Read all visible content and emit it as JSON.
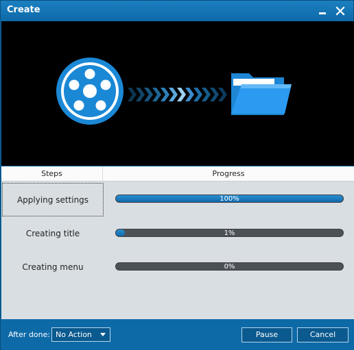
{
  "window": {
    "title": "Create"
  },
  "table": {
    "header_steps": "Steps",
    "header_progress": "Progress",
    "rows": [
      {
        "step": "Applying settings",
        "progress": 100,
        "progress_text": "100%"
      },
      {
        "step": "Creating title",
        "progress": 1,
        "progress_text": "1%"
      },
      {
        "step": "Creating menu",
        "progress": 0,
        "progress_text": "0%"
      }
    ]
  },
  "footer": {
    "after_done_label": "After done:",
    "after_done_value": "No Action",
    "pause_label": "Pause",
    "cancel_label": "Cancel"
  },
  "colors": {
    "accent": "#0d6aa7",
    "bar_fill": "#1a7cc0",
    "bar_track": "#4c5157"
  },
  "icons": [
    "film-reel-icon",
    "arrow-chevrons-icon",
    "folder-icon",
    "minimize-icon",
    "close-icon"
  ]
}
